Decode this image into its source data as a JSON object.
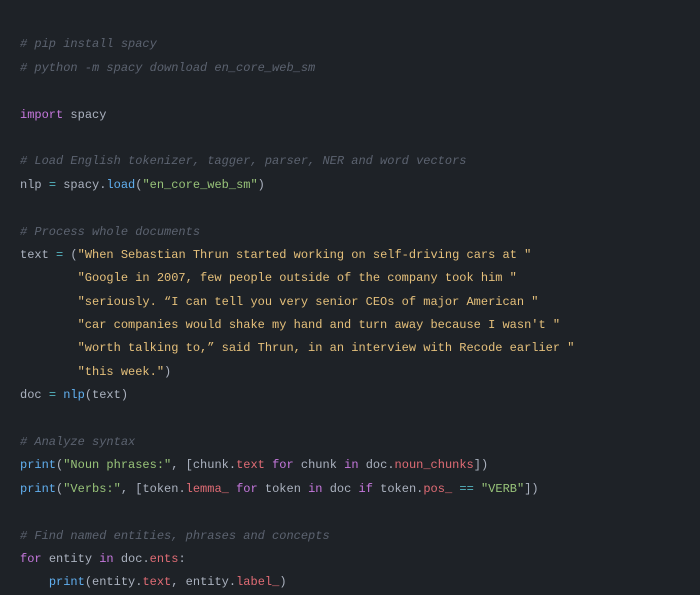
{
  "comments": {
    "c1": "# pip install spacy",
    "c2": "# python -m spacy download en_core_web_sm",
    "c3": "# Load English tokenizer, tagger, parser, NER and word vectors",
    "c4": "# Process whole documents",
    "c5": "# Analyze syntax",
    "c6": "# Find named entities, phrases and concepts"
  },
  "kw": {
    "import": "import",
    "for": "for",
    "in": "in",
    "if": "if"
  },
  "mod": {
    "spacy": "spacy"
  },
  "vars": {
    "nlp": "nlp",
    "text": "text",
    "doc": "doc",
    "chunk": "chunk",
    "token": "token",
    "entity": "entity"
  },
  "attrs": {
    "load": "load",
    "noun_chunks": "noun_chunks",
    "text_attr": "text",
    "lemma": "lemma_",
    "pos": "pos_",
    "ents": "ents",
    "label": "label_"
  },
  "fns": {
    "print": "print",
    "nlp_call": "nlp"
  },
  "strings": {
    "model": "\"en_core_web_sm\"",
    "s1": "\"When Sebastian Thrun started working on self-driving cars at \"",
    "s2": "\"Google in 2007, few people outside of the company took him \"",
    "s3": "\"seriously. “I can tell you very senior CEOs of major American \"",
    "s4": "\"car companies would shake my hand and turn away because I wasn't \"",
    "s5": "\"worth talking to,” said Thrun, in an interview with Recode earlier \"",
    "s6": "\"this week.\"",
    "noun_label": "\"Noun phrases:\"",
    "verb_label": "\"Verbs:\"",
    "verb_lit": "\"VERB\""
  },
  "ops": {
    "eq": "=",
    "eqeq": "=="
  },
  "punct": {
    "dot": ".",
    "lparen": "(",
    "rparen": ")",
    "lbrack": "[",
    "rbrack": "]",
    "comma": ",",
    "colon": ":",
    "sp": " "
  },
  "indent": {
    "s8": "        ",
    "s4": "    "
  }
}
